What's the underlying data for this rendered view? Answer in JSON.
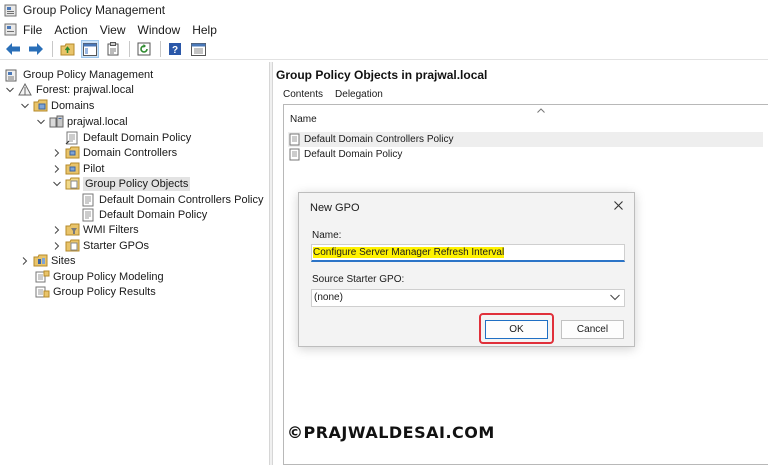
{
  "window": {
    "title": "Group Policy Management"
  },
  "menu": [
    "File",
    "Action",
    "View",
    "Window",
    "Help"
  ],
  "toolbar": {
    "icons": [
      "back-arrow-icon",
      "forward-arrow-icon",
      "up-folder-icon",
      "show-tree-icon",
      "properties-icon",
      "refresh-icon",
      "help-icon",
      "console-icon"
    ]
  },
  "tree": {
    "root": "Group Policy Management",
    "forest": "Forest: prajwal.local",
    "domains": "Domains",
    "domain": "prajwal.local",
    "default_domain_policy": "Default Domain Policy",
    "domain_controllers": "Domain Controllers",
    "pilot": "Pilot",
    "gpo_container": "Group Policy Objects",
    "gpo_ddcp": "Default Domain Controllers Policy",
    "gpo_ddp": "Default Domain Policy",
    "wmi_filters": "WMI Filters",
    "starter_gpos": "Starter GPOs",
    "sites": "Sites",
    "modeling": "Group Policy Modeling",
    "results": "Group Policy Results"
  },
  "right": {
    "title": "Group Policy Objects in prajwal.local",
    "tabs": [
      "Contents",
      "Delegation"
    ],
    "column_name": "Name",
    "rows": [
      "Default Domain Controllers Policy",
      "Default Domain Policy"
    ]
  },
  "dialog": {
    "title": "New GPO",
    "name_label": "Name:",
    "name_value": "Configure Server Manager Refresh Interval",
    "starter_label": "Source Starter GPO:",
    "starter_value": "(none)",
    "ok": "OK",
    "cancel": "Cancel"
  },
  "watermark": "©PRAJWALDESAI.COM",
  "colors": {
    "selection": "#cde3f7",
    "accent": "#2b74c7",
    "highlight": "#fff200",
    "annotation": "#e0303a"
  }
}
